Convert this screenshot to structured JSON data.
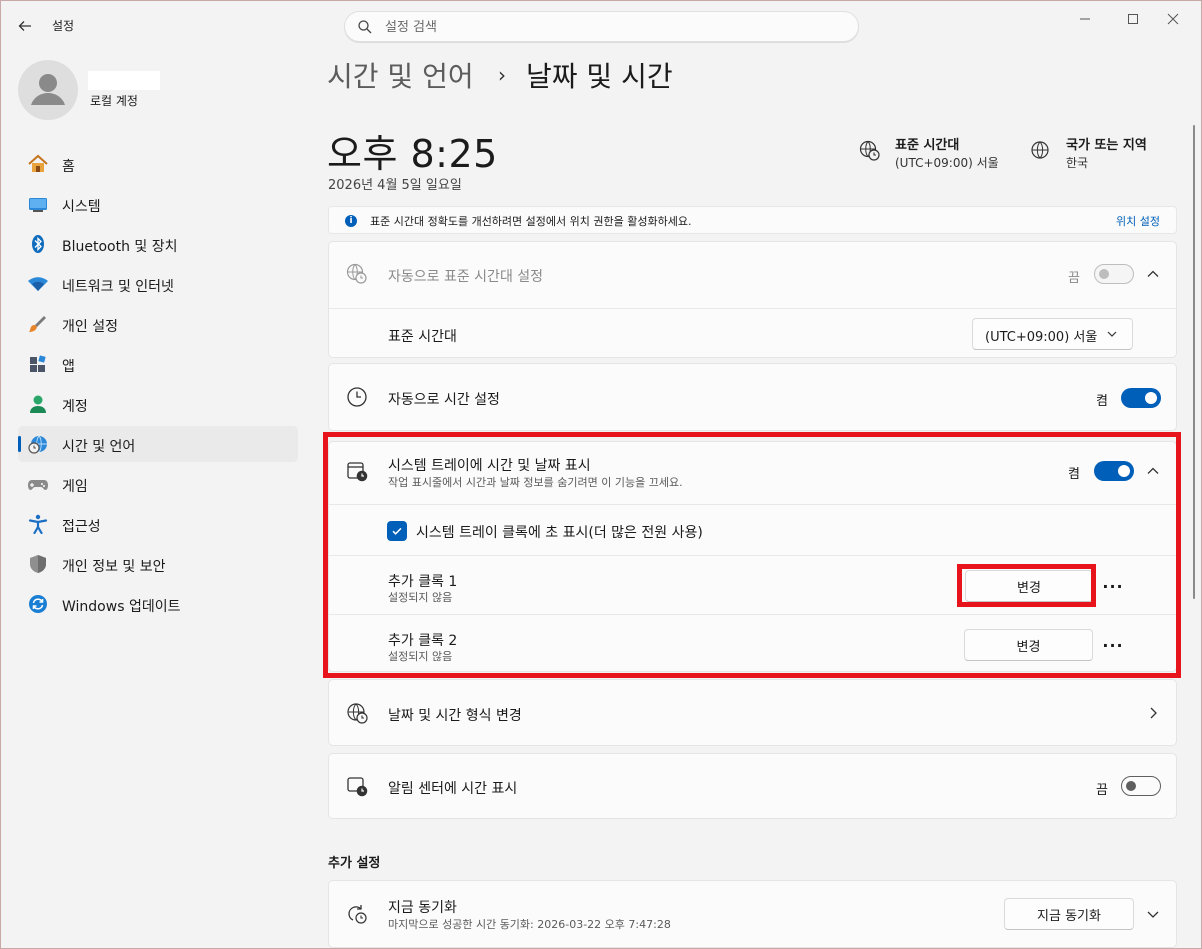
{
  "app": {
    "title": "설정"
  },
  "search": {
    "placeholder": "설정 검색"
  },
  "window_controls": {
    "minimize": "—",
    "maximize": "☐",
    "close": "✕"
  },
  "user": {
    "subtitle": "로컬 계정"
  },
  "sidebar": {
    "items": [
      {
        "label": "홈",
        "icon": "home-icon"
      },
      {
        "label": "시스템",
        "icon": "system-icon"
      },
      {
        "label": "Bluetooth 및 장치",
        "icon": "bluetooth-icon"
      },
      {
        "label": "네트워크 및 인터넷",
        "icon": "wifi-icon"
      },
      {
        "label": "개인 설정",
        "icon": "brush-icon"
      },
      {
        "label": "앱",
        "icon": "apps-icon"
      },
      {
        "label": "계정",
        "icon": "account-icon"
      },
      {
        "label": "시간 및 언어",
        "icon": "time-language-icon",
        "active": true
      },
      {
        "label": "게임",
        "icon": "gamepad-icon"
      },
      {
        "label": "접근성",
        "icon": "accessibility-icon"
      },
      {
        "label": "개인 정보 및 보안",
        "icon": "shield-icon"
      },
      {
        "label": "Windows 업데이트",
        "icon": "update-icon"
      }
    ]
  },
  "breadcrumb": {
    "parent": "시간 및 언어",
    "separator": "›",
    "current": "날짜 및 시간"
  },
  "clock": {
    "time": "오후 8:25",
    "date": "2026년 4월 5일 일요일"
  },
  "timezone_info": {
    "title": "표준 시간대",
    "value": "(UTC+09:00) 서울"
  },
  "region_info": {
    "title": "국가 또는 지역",
    "value": "한국"
  },
  "banner": {
    "text": "표준 시간대 정확도를 개선하려면 설정에서 위치 권한을 활성화하세요.",
    "link": "위치 설정"
  },
  "auto_timezone": {
    "title": "자동으로 표준 시간대 설정",
    "state": "끔",
    "timezone_label": "표준 시간대",
    "timezone_value": "(UTC+09:00) 서울"
  },
  "auto_time": {
    "title": "자동으로 시간 설정",
    "state": "켬"
  },
  "tray": {
    "title": "시스템 트레이에 시간 및 날짜 표시",
    "subtitle": "작업 표시줄에서 시간과 날짜 정보를 숨기려면 이 기능을 끄세요.",
    "state": "켬",
    "seconds_label": "시스템 트레이 클록에 초 표시(더 많은 전원 사용)",
    "clock1_title": "추가 클록 1",
    "clock1_sub": "설정되지 않음",
    "clock1_btn": "변경",
    "clock2_title": "추가 클록 2",
    "clock2_sub": "설정되지 않음",
    "clock2_btn": "변경",
    "more": "···"
  },
  "format": {
    "title": "날짜 및 시간 형식 변경"
  },
  "notif": {
    "title": "알림 센터에 시간 표시",
    "state": "끔"
  },
  "additional": {
    "section_title": "추가 설정",
    "sync_title": "지금 동기화",
    "sync_sub": "마지막으로 성공한 시간 동기화: 2026-03-22 오후 7:47:28",
    "sync_btn": "지금 동기화"
  },
  "colors": {
    "accent": "#005fb8",
    "highlight": "#e8141c"
  }
}
